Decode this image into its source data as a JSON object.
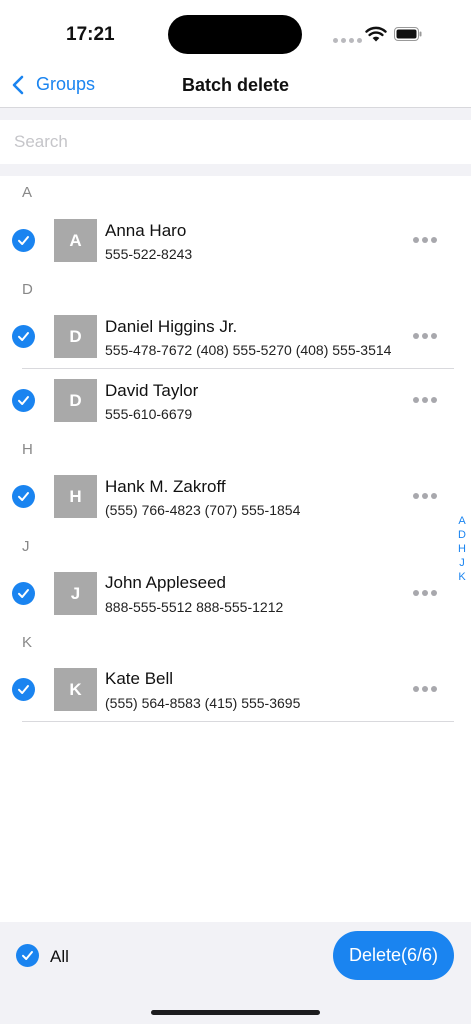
{
  "status_bar": {
    "time": "17:21"
  },
  "nav": {
    "back_label": "Groups",
    "title": "Batch delete"
  },
  "search": {
    "placeholder": "Search",
    "value": ""
  },
  "sections": [
    {
      "letter": "A",
      "contacts": [
        {
          "initial": "A",
          "name": "Anna Haro",
          "phones": "555-522-8243",
          "selected": true
        }
      ]
    },
    {
      "letter": "D",
      "contacts": [
        {
          "initial": "D",
          "name": "Daniel Higgins Jr.",
          "phones": "555-478-7672  (408) 555-5270  (408) 555-3514",
          "selected": true
        },
        {
          "initial": "D",
          "name": "David Taylor",
          "phones": "555-610-6679",
          "selected": true
        }
      ]
    },
    {
      "letter": "H",
      "contacts": [
        {
          "initial": "H",
          "name": "Hank M. Zakroff",
          "phones": "(555) 766-4823  (707) 555-1854",
          "selected": true
        }
      ]
    },
    {
      "letter": "J",
      "contacts": [
        {
          "initial": "J",
          "name": "John Appleseed",
          "phones": "888-555-5512  888-555-1212",
          "selected": true
        }
      ]
    },
    {
      "letter": "K",
      "contacts": [
        {
          "initial": "K",
          "name": "Kate Bell",
          "phones": "(555) 564-8583  (415) 555-3695",
          "selected": true
        }
      ]
    }
  ],
  "index_letters": [
    "A",
    "D",
    "H",
    "J",
    "K"
  ],
  "toolbar": {
    "all_label": "All",
    "delete_label": "Delete(6/6)"
  },
  "colors": {
    "accent": "#1a84f0",
    "avatar": "#a9a9a9"
  }
}
